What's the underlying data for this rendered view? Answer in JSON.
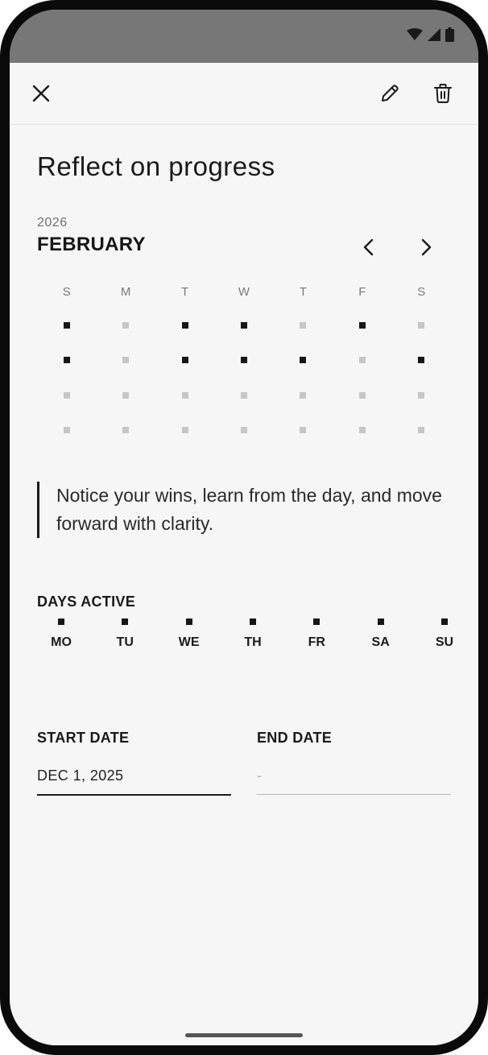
{
  "status_bar": {
    "icons": [
      "wifi-icon",
      "cellular-signal-icon",
      "battery-icon"
    ]
  },
  "toolbar": {
    "close_icon": "close-icon",
    "edit_icon": "pencil-icon",
    "delete_icon": "trash-icon"
  },
  "page": {
    "title": "Reflect on progress"
  },
  "calendar": {
    "year": "2026",
    "month": "FEBRUARY",
    "prev_icon": "chevron-left-icon",
    "next_icon": "chevron-right-icon",
    "weekday_headers": [
      "S",
      "M",
      "T",
      "W",
      "T",
      "F",
      "S"
    ],
    "weeks": [
      [
        true,
        false,
        true,
        true,
        false,
        true,
        false
      ],
      [
        true,
        false,
        true,
        true,
        true,
        false,
        true
      ],
      [
        false,
        false,
        false,
        false,
        false,
        false,
        false
      ],
      [
        false,
        false,
        false,
        false,
        false,
        false,
        false
      ]
    ],
    "colors": {
      "active": "#161616",
      "inactive": "#c6c6ca"
    }
  },
  "quote": {
    "text": "Notice your wins, learn from the day, and move forward with clarity."
  },
  "days_active": {
    "label": "DAYS ACTIVE",
    "days": [
      {
        "label": "MO",
        "active": true
      },
      {
        "label": "TU",
        "active": true
      },
      {
        "label": "WE",
        "active": true
      },
      {
        "label": "TH",
        "active": true
      },
      {
        "label": "FR",
        "active": true
      },
      {
        "label": "SA",
        "active": true
      },
      {
        "label": "SU",
        "active": true
      }
    ]
  },
  "dates": {
    "start_label": "START DATE",
    "start_value": "DEC 1, 2025",
    "end_label": "END DATE",
    "end_value": "-"
  }
}
